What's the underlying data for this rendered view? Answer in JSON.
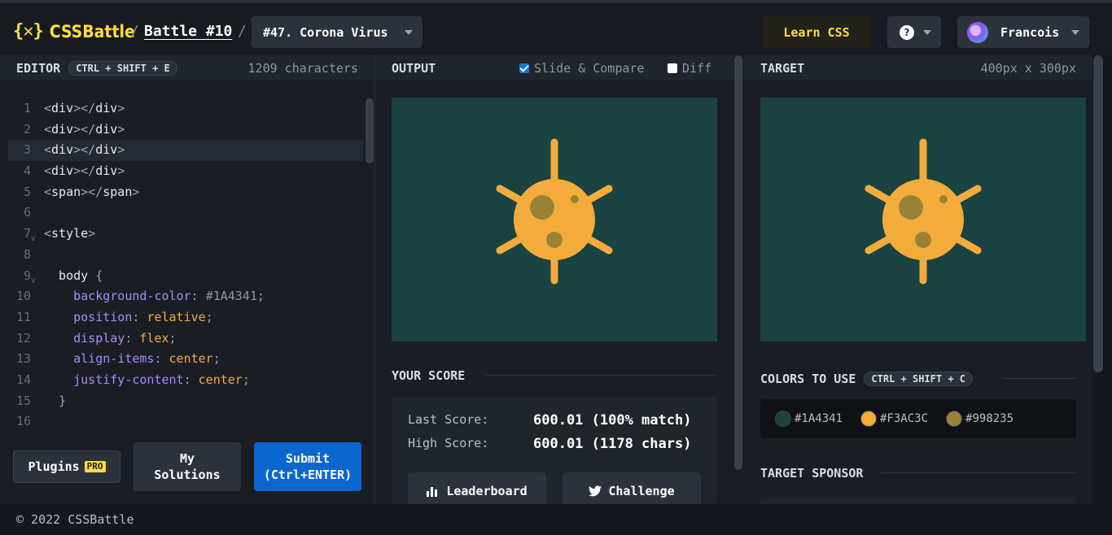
{
  "header": {
    "logo_mark": "{✕}",
    "logo_text": "CSSBattle",
    "sep": "/",
    "battle": "Battle #10",
    "target_select": "#47. Corona Virus",
    "learn_css": "Learn CSS",
    "help": "?",
    "user": "Francois"
  },
  "editor": {
    "title": "EDITOR",
    "shortcut": "CTRL + SHIFT + E",
    "char_count": "1209 characters",
    "lines": [
      {
        "n": "1",
        "parts": [
          [
            "punct",
            "<"
          ],
          [
            "tag",
            "div"
          ],
          [
            "punct",
            "></"
          ],
          [
            "tag",
            "div"
          ],
          [
            "punct",
            ">"
          ]
        ]
      },
      {
        "n": "2",
        "parts": [
          [
            "punct",
            "<"
          ],
          [
            "tag",
            "div"
          ],
          [
            "punct",
            "></"
          ],
          [
            "tag",
            "div"
          ],
          [
            "punct",
            ">"
          ]
        ]
      },
      {
        "n": "3",
        "parts": [
          [
            "punct",
            "<"
          ],
          [
            "tag",
            "div"
          ],
          [
            "punct",
            "></"
          ],
          [
            "tag",
            "div"
          ],
          [
            "punct",
            ">"
          ]
        ]
      },
      {
        "n": "4",
        "parts": [
          [
            "punct",
            "<"
          ],
          [
            "tag",
            "div"
          ],
          [
            "punct",
            "></"
          ],
          [
            "tag",
            "div"
          ],
          [
            "punct",
            ">"
          ]
        ]
      },
      {
        "n": "5",
        "parts": [
          [
            "punct",
            "<"
          ],
          [
            "tag",
            "span"
          ],
          [
            "punct",
            "></"
          ],
          [
            "tag",
            "span"
          ],
          [
            "punct",
            ">"
          ]
        ]
      },
      {
        "n": "6",
        "parts": []
      },
      {
        "n": "7",
        "fold": "v",
        "parts": [
          [
            "punct",
            "<"
          ],
          [
            "tag",
            "style"
          ],
          [
            "punct",
            ">"
          ]
        ]
      },
      {
        "n": "8",
        "parts": []
      },
      {
        "n": "9",
        "fold": "v",
        "parts": [
          [
            "sel",
            "  body "
          ],
          [
            "punct",
            "{"
          ]
        ]
      },
      {
        "n": "10",
        "parts": [
          [
            "sel",
            "    "
          ],
          [
            "prop",
            "background-color"
          ],
          [
            "punct",
            ": "
          ],
          [
            "hex",
            "#1A4341"
          ],
          [
            "punct",
            ";"
          ]
        ]
      },
      {
        "n": "11",
        "parts": [
          [
            "sel",
            "    "
          ],
          [
            "prop",
            "position"
          ],
          [
            "punct",
            ": "
          ],
          [
            "val",
            "relative"
          ],
          [
            "punct",
            ";"
          ]
        ]
      },
      {
        "n": "12",
        "parts": [
          [
            "sel",
            "    "
          ],
          [
            "prop",
            "display"
          ],
          [
            "punct",
            ": "
          ],
          [
            "val",
            "flex"
          ],
          [
            "punct",
            ";"
          ]
        ]
      },
      {
        "n": "13",
        "parts": [
          [
            "sel",
            "    "
          ],
          [
            "prop",
            "align-items"
          ],
          [
            "punct",
            ": "
          ],
          [
            "val",
            "center"
          ],
          [
            "punct",
            ";"
          ]
        ]
      },
      {
        "n": "14",
        "parts": [
          [
            "sel",
            "    "
          ],
          [
            "prop",
            "justify-content"
          ],
          [
            "punct",
            ": "
          ],
          [
            "val",
            "center"
          ],
          [
            "punct",
            ";"
          ]
        ]
      },
      {
        "n": "15",
        "parts": [
          [
            "sel",
            "  "
          ],
          [
            "punct",
            "}"
          ]
        ]
      },
      {
        "n": "16",
        "parts": []
      }
    ],
    "active_line": 3,
    "plugins": "Plugins",
    "pro": "PRO",
    "my_solutions": "My\nSolutions",
    "submit": "Submit\n(Ctrl+ENTER)"
  },
  "output": {
    "title": "OUTPUT",
    "slide_compare": "Slide & Compare",
    "slide_checked": true,
    "diff": "Diff",
    "diff_checked": false,
    "your_score": "YOUR SCORE",
    "last_label": "Last Score:",
    "last_value": "600.01 (100% match)",
    "high_label": "High Score:",
    "high_value": "600.01 (1178 chars)",
    "leaderboard": "Leaderboard",
    "challenge": "Challenge"
  },
  "target": {
    "title": "TARGET",
    "size": "400px x 300px",
    "colors_title": "COLORS TO USE",
    "colors_shortcut": "CTRL + SHIFT + C",
    "colors": [
      {
        "hex": "#1A4341",
        "label": "#1A4341"
      },
      {
        "hex": "#F3AC3C",
        "label": "#F3AC3C"
      },
      {
        "hex": "#998235",
        "label": "#998235"
      }
    ],
    "sponsor": "TARGET SPONSOR"
  },
  "footer": "© 2022 CSSBattle"
}
